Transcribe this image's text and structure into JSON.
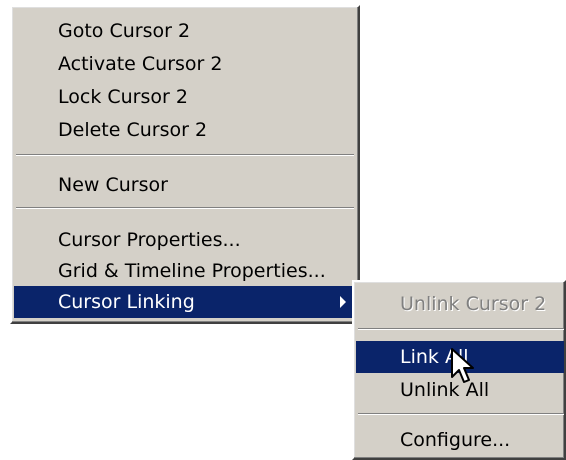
{
  "main_menu": {
    "items": [
      {
        "label": "Goto Cursor 2"
      },
      {
        "label": "Activate Cursor 2"
      },
      {
        "label": "Lock Cursor 2"
      },
      {
        "label": "Delete Cursor 2"
      },
      {
        "label": "New Cursor"
      },
      {
        "label": "Cursor Properties..."
      },
      {
        "label": "Grid & Timeline Properties..."
      },
      {
        "label": "Cursor Linking",
        "state": "highlighted",
        "has_submenu": true
      }
    ]
  },
  "submenu": {
    "items": [
      {
        "label": "Unlink Cursor 2",
        "state": "disabled"
      },
      {
        "label": "Link All",
        "state": "highlighted"
      },
      {
        "label": "Unlink All"
      },
      {
        "label": "Configure..."
      }
    ]
  },
  "colors": {
    "menu_background": "#d4d0c8",
    "highlight": "#0a246a",
    "disabled_text": "#808080"
  },
  "icons": {
    "pointer": "mouse-pointer-icon",
    "submenu_arrow": "submenu-arrow-icon"
  }
}
